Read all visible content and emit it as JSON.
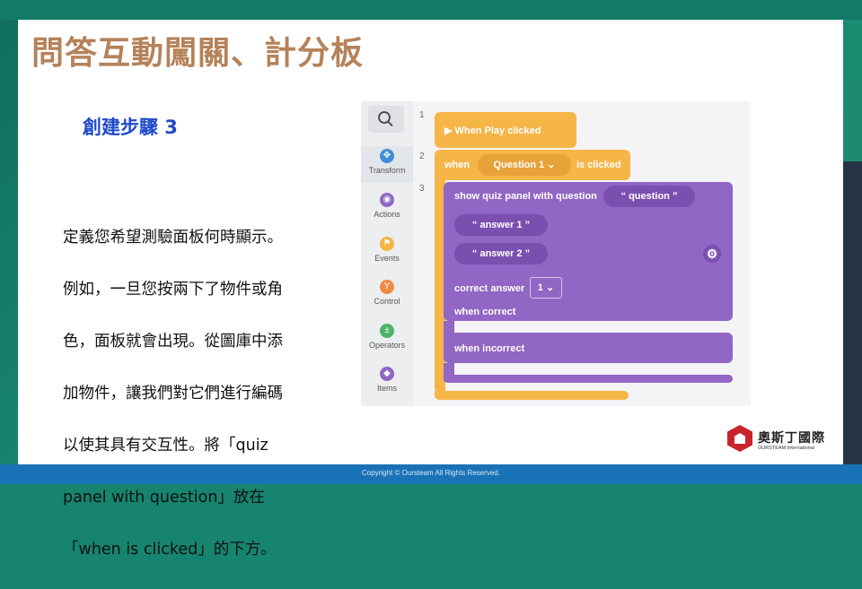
{
  "slide": {
    "title": "問答互動闖關、計分板",
    "step_heading": "創建步驟 3",
    "description_lines": [
      "定義您希望測驗面板何時顯示。",
      "例如，一旦您按兩下了物件或角",
      "色，面板就會出現。從圖庫中添",
      "加物件，讓我們對它們進行編碼",
      "以使其具有交互性。將「quiz",
      "panel with question」放在",
      "「when is clicked」的下方。"
    ],
    "footer": "Copyright © Oursteam All Rights Reserved."
  },
  "editor": {
    "sidebar": [
      {
        "label": "Transform",
        "icon": "transform-icon",
        "color": "#3f8fd6"
      },
      {
        "label": "Actions",
        "icon": "eye-icon",
        "color": "#9166c4"
      },
      {
        "label": "Events",
        "icon": "flag-icon",
        "color": "#f6b547"
      },
      {
        "label": "Control",
        "icon": "branch-icon",
        "color": "#ef8a45"
      },
      {
        "label": "Operators",
        "icon": "plus-minus-icon",
        "color": "#4eb36a"
      },
      {
        "label": "Items",
        "icon": "cube-icon",
        "color": "#9166c4"
      }
    ],
    "line_numbers": [
      "1",
      "2",
      "3"
    ],
    "blocks": {
      "play": "▶ When Play clicked",
      "when": "when",
      "question_select": "Question 1",
      "is_clicked": "is clicked",
      "show_quiz": "show quiz panel with question",
      "question_field": "“  question  ”",
      "answer1": "“  answer 1  ”",
      "answer2": "“  answer 2  ”",
      "correct_answer": "correct answer",
      "correct_value": "1",
      "when_correct": "when correct",
      "when_incorrect": "when incorrect"
    }
  },
  "logo": {
    "name_zh": "奧斯丁國際",
    "name_en": "OURSTEAM International"
  },
  "colors": {
    "title": "#b5825a",
    "step": "#1f49c9",
    "orange_block": "#f6b547",
    "purple_block": "#9166c4",
    "footer": "#1a72b6"
  }
}
